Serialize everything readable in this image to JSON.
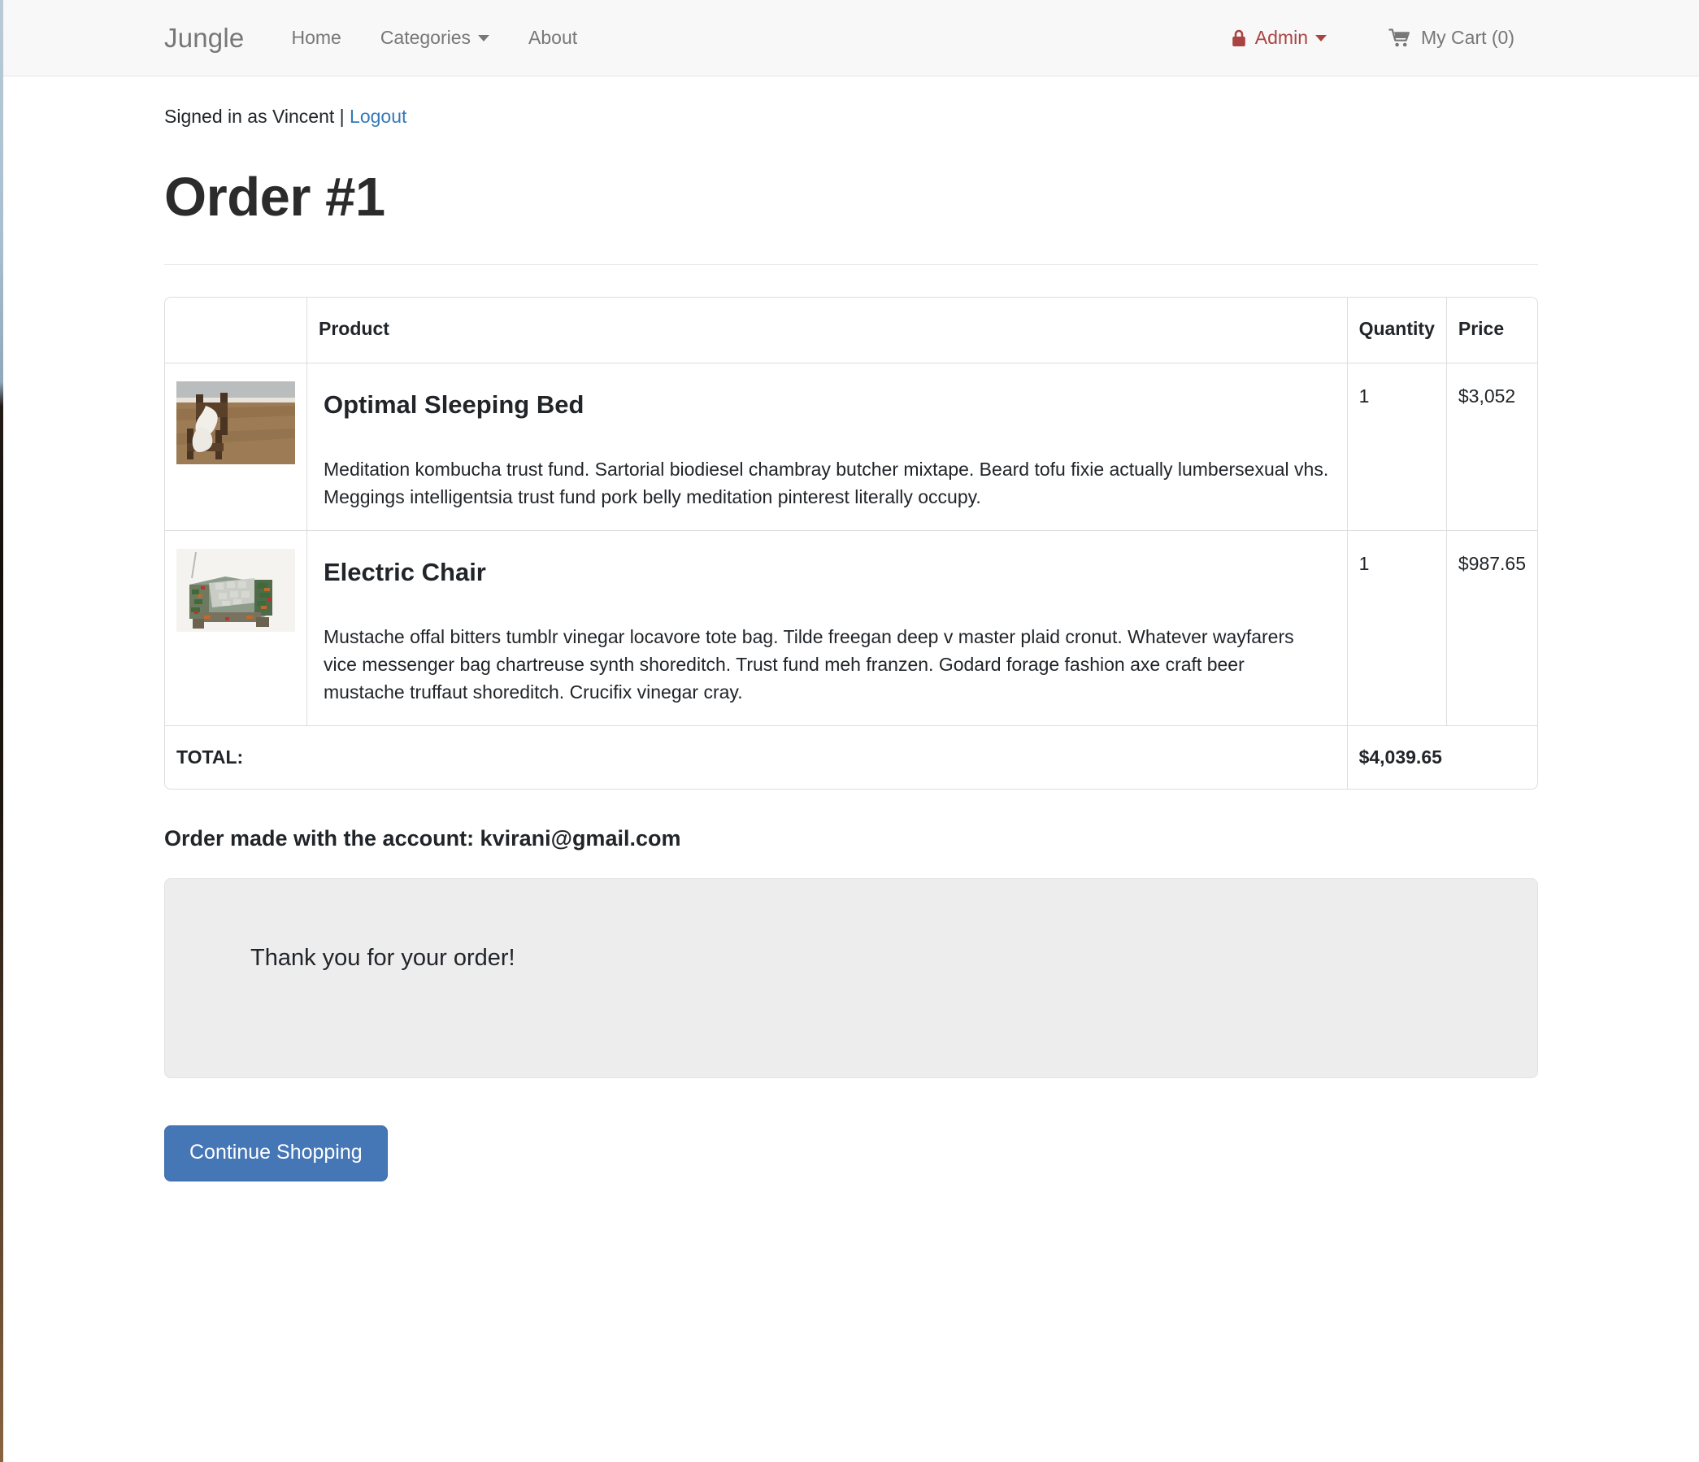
{
  "navbar": {
    "brand": "Jungle",
    "links": [
      {
        "label": "Home",
        "name": "home"
      },
      {
        "label": "Categories",
        "name": "categories",
        "caret": true
      },
      {
        "label": "About",
        "name": "about"
      }
    ],
    "admin": {
      "label": "Admin",
      "icon": "lock-icon",
      "color": "#a94442"
    },
    "cart": {
      "label": "My Cart (0)",
      "icon": "shopping-cart-icon",
      "count": 0
    }
  },
  "session": {
    "signed_in_prefix": "Signed in as Vincent",
    "separator": "|",
    "logout_label": "Logout",
    "link_color": "#337ab7"
  },
  "page": {
    "title": "Order #1"
  },
  "order_table": {
    "headers": {
      "product": "Product",
      "quantity": "Quantity",
      "price": "Price"
    },
    "rows": [
      {
        "name": "Optimal Sleeping Bed",
        "description": "Meditation kombucha trust fund. Sartorial biodiesel chambray butcher mixtape. Beard tofu fixie actually lumbersexual vhs. Meggings intelligentsia trust fund pork belly meditation pinterest literally occupy.",
        "quantity": "1",
        "price": "$3,052",
        "thumb_alt": "wooden-bed-photo"
      },
      {
        "name": "Electric Chair",
        "description": "Mustache offal bitters tumblr vinegar locavore tote bag. Tilde freegan deep v master plaid cronut. Whatever wayfarers vice messenger bag chartreuse synth shoreditch. Trust fund meh franzen. Godard forage fashion axe craft beer mustache truffaut shoreditch. Crucifix vinegar cray.",
        "quantity": "1",
        "price": "$987.65",
        "thumb_alt": "circuit-board-armchair-photo"
      }
    ],
    "total_label": "TOTAL:",
    "total_value": "$4,039.65"
  },
  "footer_section": {
    "account_line": "Order made with the account: kvirani@gmail.com",
    "thank_you": "Thank you for your order!",
    "continue_button": "Continue Shopping",
    "button_color": "#4576b5"
  }
}
